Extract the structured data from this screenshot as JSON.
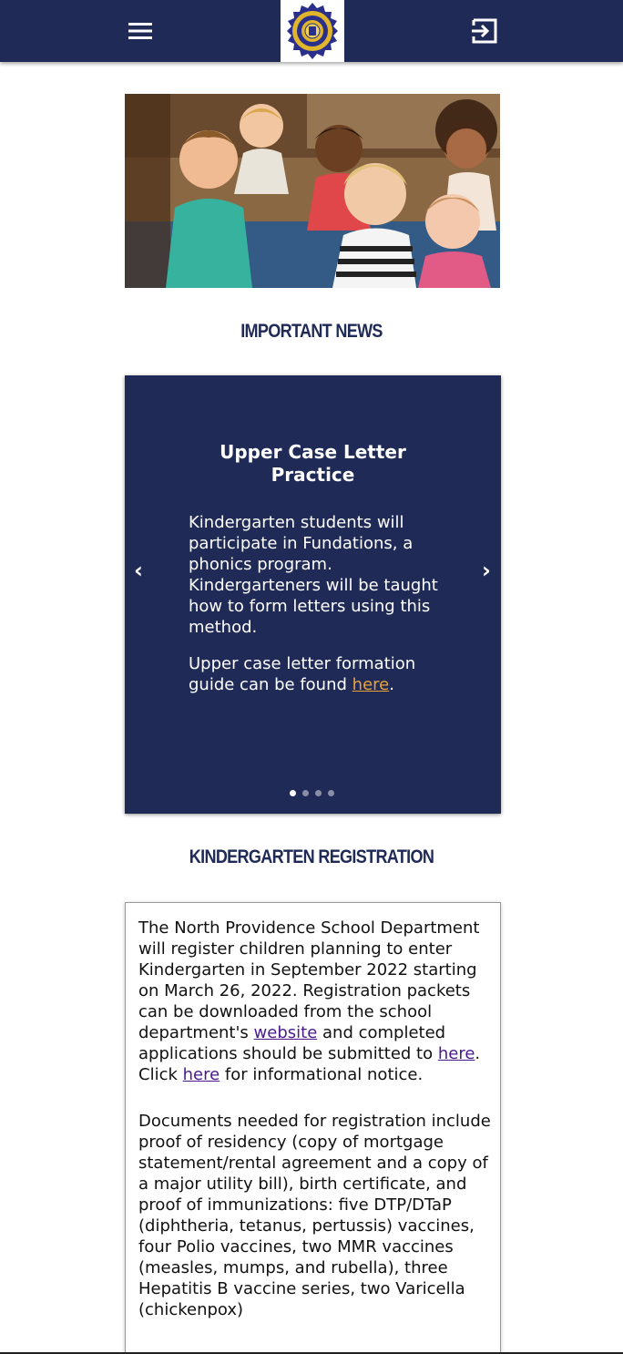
{
  "header": {
    "menu_icon": "hamburger-menu-icon",
    "logo_text": "NORTH PROVIDENCE SCHOOL DEPARTMENT",
    "exit_icon": "sign-out-icon",
    "bar_color": "#1f2a57"
  },
  "news": {
    "heading": "IMPORTANT NEWS",
    "card": {
      "title": "Upper Case Letter Practice",
      "paragraph1": "Kindergarten students will participate in Fundations, a phonics program. Kindergarteners will be taught how to form letters using this method.",
      "paragraph2_prefix": "Upper case letter formation guide can be found ",
      "paragraph2_link": "here",
      "paragraph2_suffix": "."
    },
    "prev_arrow": "‹",
    "next_arrow": "›",
    "slide_count": 4,
    "active_slide": 1,
    "link_color": "#e8a33b"
  },
  "registration": {
    "heading": "KINDERGARTEN REGISTRATION",
    "p1_a": "The North Providence School Department will register children planning to enter Kindergarten in September 2022 starting on March 26, 2022. Registration packets can be downloaded from the school department's ",
    "p1_link1": "website",
    "p1_b": " and completed applications should be submitted to ",
    "p1_link2": "here",
    "p1_c": ". Click ",
    "p1_link3": "here",
    "p1_d": " for informational notice.",
    "p2": "Documents needed for registration include proof of residency (copy of mortgage statement/rental agreement and a copy of a major utility bill), birth certificate, and proof of immunizations: five DTP/DTaP (diphtheria, tetanus, pertussis) vaccines, four Polio vaccines, two MMR vaccines (measles, mumps, and rubella), three Hepatitis B vaccine series, two Varicella (chickenpox)"
  },
  "colors": {
    "brand_navy": "#1f2a57",
    "visited_link": "#4a1a8c"
  }
}
